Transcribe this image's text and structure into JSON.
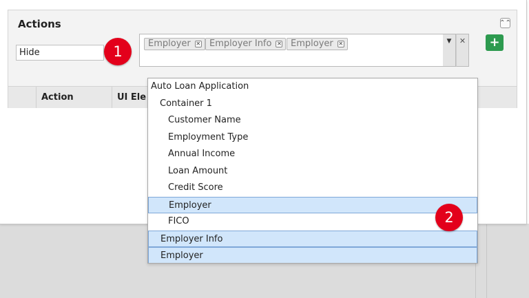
{
  "actions": {
    "title": "Actions",
    "collapse_icon": "⌃⌃",
    "action_value": "Hide",
    "add_icon": "+",
    "selected_chips": [
      "Employer",
      "Employer Info",
      "Employer"
    ],
    "table_headers": [
      "Action",
      "UI Ele"
    ]
  },
  "callouts": [
    "1",
    "2"
  ],
  "dropdown": {
    "options": [
      {
        "label": "Auto Loan Application",
        "level": 0,
        "selected": false
      },
      {
        "label": "Container 1",
        "level": 1,
        "selected": false
      },
      {
        "label": "Customer Name",
        "level": 2,
        "selected": false
      },
      {
        "label": "Employment Type",
        "level": 2,
        "selected": false
      },
      {
        "label": "Annual Income",
        "level": 2,
        "selected": false
      },
      {
        "label": "Loan Amount",
        "level": 2,
        "selected": false
      },
      {
        "label": "Credit Score",
        "level": 2,
        "selected": false
      },
      {
        "label": "Employer",
        "level": 2,
        "selected": true
      },
      {
        "label": "FICO",
        "level": 2,
        "selected": false
      },
      {
        "label": "Employer Info",
        "level": 1,
        "selected": true
      },
      {
        "label": "Employer",
        "level": 1,
        "selected": true
      }
    ]
  },
  "colors": {
    "badge": "#e3001b",
    "add_button": "#2d9a4f",
    "selected_option": "#d1e6fb"
  }
}
